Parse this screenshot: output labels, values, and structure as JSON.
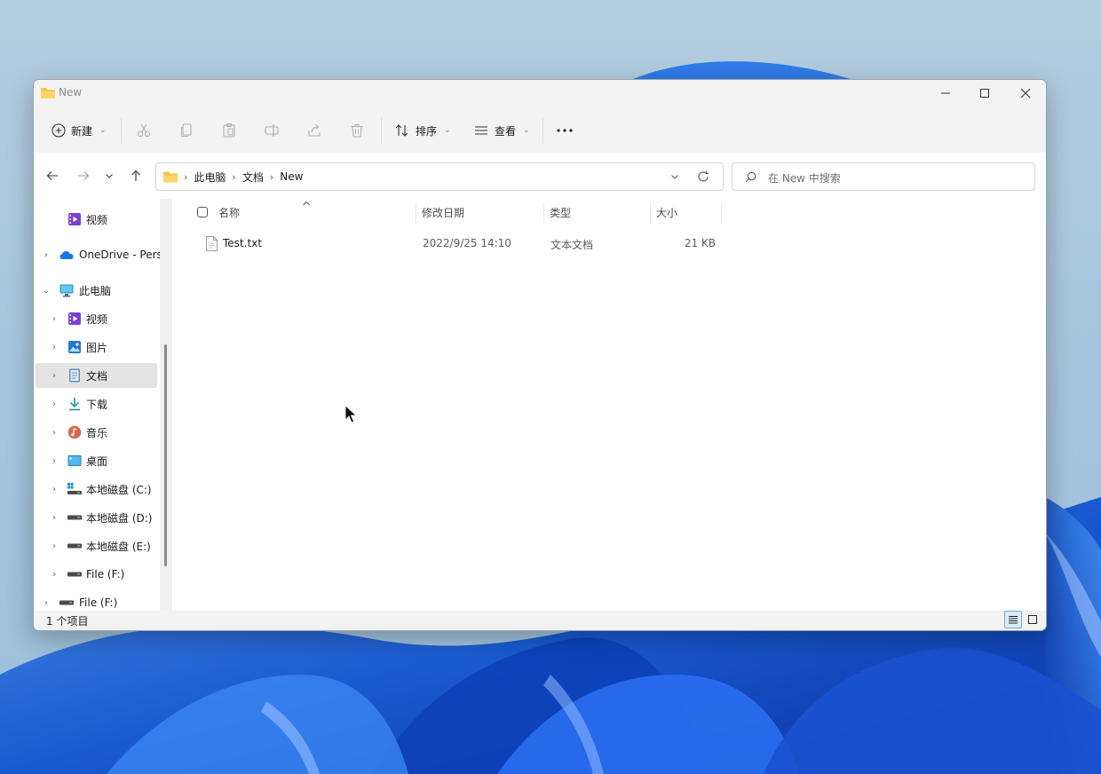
{
  "window": {
    "title": "New"
  },
  "command_bar": {
    "new_label": "新建",
    "sort_label": "排序",
    "view_label": "查看",
    "icons": [
      "cut-icon",
      "copy-icon",
      "paste-icon",
      "rename-icon",
      "share-icon",
      "delete-icon",
      "more-icon"
    ]
  },
  "address": {
    "crumbs": [
      "此电脑",
      "文档",
      "New"
    ],
    "search_placeholder": "在 New 中搜索"
  },
  "navigation": {
    "items": [
      {
        "label": "视频",
        "icon": "video-icon"
      },
      {
        "label": "OneDrive - Pers",
        "icon": "onedrive-icon"
      },
      {
        "label": "此电脑",
        "icon": "this-pc-icon"
      },
      {
        "label": "视频",
        "icon": "video-icon"
      },
      {
        "label": "图片",
        "icon": "pictures-icon"
      },
      {
        "label": "文档",
        "icon": "documents-icon",
        "selected": true
      },
      {
        "label": "下载",
        "icon": "download-icon"
      },
      {
        "label": "音乐",
        "icon": "music-icon"
      },
      {
        "label": "桌面",
        "icon": "desktop-icon"
      },
      {
        "label": "本地磁盘 (C:)",
        "icon": "windows-drive-icon"
      },
      {
        "label": "本地磁盘 (D:)",
        "icon": "drive-icon"
      },
      {
        "label": "本地磁盘 (E:)",
        "icon": "drive-icon"
      },
      {
        "label": "File (F:)",
        "icon": "drive-icon"
      },
      {
        "label": "File (F:)",
        "icon": "drive-icon"
      }
    ]
  },
  "file_list": {
    "columns": [
      "名称",
      "修改日期",
      "类型",
      "大小"
    ],
    "rows": [
      {
        "name": "Test.txt",
        "modified": "2022/9/25 14:10",
        "type": "文本文档",
        "size": "21 KB"
      }
    ]
  },
  "status_bar": {
    "count": "1 个项目"
  },
  "colors": {
    "accent": "#0067c0",
    "folder": "#f8c24b",
    "selection": "#e3e3e3"
  }
}
